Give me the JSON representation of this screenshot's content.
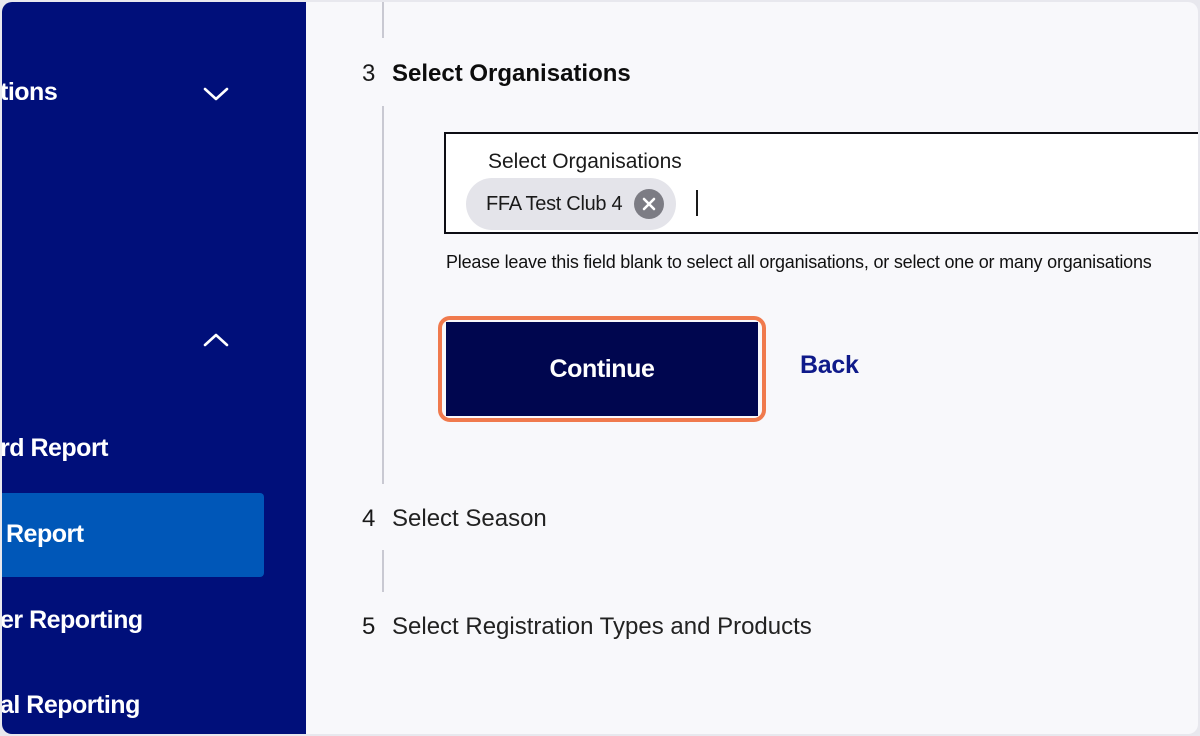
{
  "sidebar": {
    "items": [
      {
        "label": "tions",
        "chevron": "chevron-down-icon"
      },
      {
        "chevron": "chevron-up-icon"
      },
      {
        "label": "rd Report"
      },
      {
        "label": "Report",
        "active": true
      },
      {
        "label": "er Reporting"
      },
      {
        "label": "al Reporting"
      }
    ]
  },
  "steps": [
    {
      "number": "3",
      "title": "Select Organisations",
      "current": true
    },
    {
      "number": "4",
      "title": "Select Season"
    },
    {
      "number": "5",
      "title": "Select Registration Types and Products"
    }
  ],
  "organisations_field": {
    "label": "Select Organisations",
    "selected": [
      "FFA Test Club 4"
    ],
    "help_text": "Please leave this field blank to select all organisations, or select one or many organisations"
  },
  "actions": {
    "continue_label": "Continue",
    "back_label": "Back"
  },
  "colors": {
    "sidebar_bg": "#000f7a",
    "sidebar_active": "#0057b8",
    "primary_button": "#00064f",
    "focus_ring": "#f07a4d",
    "link": "#0f1a8a"
  }
}
